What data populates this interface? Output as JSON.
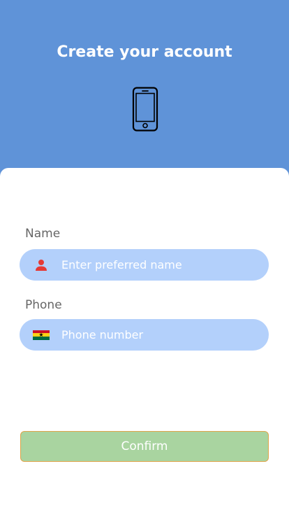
{
  "header": {
    "title": "Create your account",
    "icon": "smartphone-icon",
    "background_color": "#5f93d8"
  },
  "form": {
    "name": {
      "label": "Name",
      "placeholder": "Enter preferred name",
      "value": "",
      "icon": "person-icon",
      "icon_color": "#e53935"
    },
    "phone": {
      "label": "Phone",
      "placeholder": "Phone number",
      "value": "",
      "icon": "ghana-flag-icon"
    },
    "field_color": "#b3d0fb"
  },
  "confirm": {
    "label": "Confirm",
    "background_color": "#a9d4a0",
    "border_color": "#e0a44a"
  }
}
